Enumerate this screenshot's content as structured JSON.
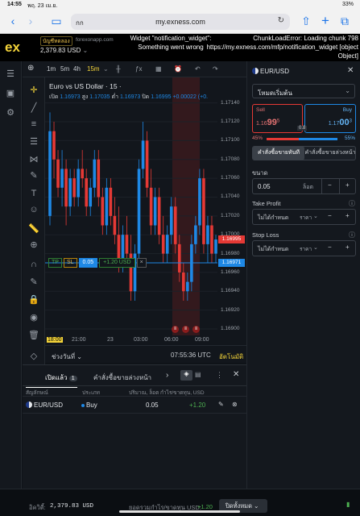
{
  "status": {
    "time": "14:55",
    "date": "พฤ. 23 เม.ย.",
    "battery": "33%"
  },
  "browser": {
    "aa": "กก",
    "url": "my.exness.com"
  },
  "header": {
    "logo": "ex",
    "account_type": "บัญชีทดลอง",
    "site": "forexonapp.com",
    "balance": "2,379.83 USD",
    "error_widget": "Widget \"notification_widget\": Something went wrong",
    "error_chunk": "ChunkLoadError: Loading chunk 798 https://my.exness.com/mfp/notification_widget [object Object]"
  },
  "chart_toolbar": {
    "timeframes": [
      "1m",
      "5m",
      "4h",
      "15m"
    ],
    "active": "15m"
  },
  "chart": {
    "title": "Euro vs US Dollar · 15 ·",
    "ohlc": {
      "open_label": "เปิด",
      "open": "1.16973",
      "high_label": "สูง",
      "high": "1.17035",
      "low_label": "ต่ำ",
      "low": "1.16973",
      "close_label": "ปิด",
      "close": "1.16995",
      "change": "+0.00022 (+0."
    },
    "price_axis": [
      "1.17140",
      "1.17120",
      "1.17100",
      "1.17080",
      "1.17060",
      "1.17040",
      "1.17020",
      "1.17000",
      "1.16980",
      "1.16960",
      "1.16940",
      "1.16920",
      "1.16900"
    ],
    "current_price": "1.16995",
    "line_price": "1.16971",
    "x_ticks": [
      "18:00",
      "21:00",
      "23",
      "03:00",
      "06:00",
      "09:00"
    ],
    "position": {
      "tp": "TP",
      "sl": "SL",
      "volume": "0.05",
      "pnl": "+1.20 USD",
      "close": "×"
    },
    "events": [
      "≡",
      "≡",
      "≡"
    ],
    "footer_range": "ช่วงวันที่",
    "clock": "07:55:36 UTC",
    "auto": "อัตโนมัติ"
  },
  "chart_data": {
    "type": "candlestick",
    "symbol": "EURUSD",
    "timeframe": "15m",
    "ylim": [
      1.169,
      1.1715
    ],
    "x_ticks": [
      "18:00",
      "21:00",
      "23",
      "03:00",
      "06:00",
      "09:00"
    ],
    "candles": [
      [
        1.1702,
        1.1713,
        1.1701,
        1.1711
      ],
      [
        1.1711,
        1.1712,
        1.1706,
        1.1708
      ],
      [
        1.1708,
        1.1709,
        1.1704,
        1.1705
      ],
      [
        1.1705,
        1.1709,
        1.1703,
        1.1707
      ],
      [
        1.1707,
        1.1708,
        1.1701,
        1.1703
      ],
      [
        1.1703,
        1.1707,
        1.1702,
        1.1706
      ],
      [
        1.1706,
        1.1707,
        1.1703,
        1.1704
      ],
      [
        1.1704,
        1.1708,
        1.1703,
        1.1707
      ],
      [
        1.1707,
        1.1709,
        1.1705,
        1.1706
      ],
      [
        1.1706,
        1.1707,
        1.1702,
        1.1703
      ],
      [
        1.1703,
        1.1706,
        1.1702,
        1.1705
      ],
      [
        1.1705,
        1.1709,
        1.1704,
        1.1708
      ],
      [
        1.1708,
        1.1709,
        1.1703,
        1.1704
      ],
      [
        1.1704,
        1.1705,
        1.17,
        1.1701
      ],
      [
        1.1701,
        1.1706,
        1.17,
        1.1705
      ],
      [
        1.1705,
        1.1706,
        1.1701,
        1.1702
      ],
      [
        1.1702,
        1.1704,
        1.1699,
        1.17
      ],
      [
        1.17,
        1.1703,
        1.1696,
        1.1697
      ],
      [
        1.1697,
        1.1701,
        1.1696,
        1.17
      ],
      [
        1.17,
        1.1702,
        1.1697,
        1.1698
      ],
      [
        1.1698,
        1.17,
        1.1693,
        1.1694
      ],
      [
        1.1694,
        1.1699,
        1.1693,
        1.1698
      ],
      [
        1.1698,
        1.1708,
        1.1697,
        1.1707
      ],
      [
        1.1707,
        1.1712,
        1.1706,
        1.171
      ],
      [
        1.171,
        1.1711,
        1.1704,
        1.1705
      ],
      [
        1.1705,
        1.1707,
        1.17,
        1.1701
      ],
      [
        1.1701,
        1.1705,
        1.17,
        1.1704
      ],
      [
        1.1704,
        1.1705,
        1.1699,
        1.17
      ],
      [
        1.17,
        1.1702,
        1.1697,
        1.1698
      ],
      [
        1.1698,
        1.1701,
        1.1697,
        1.17
      ],
      [
        1.17,
        1.1704,
        1.1699,
        1.1703
      ],
      [
        1.1703,
        1.1704,
        1.1698,
        1.1699
      ],
      [
        1.1699,
        1.17,
        1.1695,
        1.1696
      ],
      [
        1.1696,
        1.1697,
        1.1693,
        1.1694
      ],
      [
        1.1694,
        1.1696,
        1.1693,
        1.1695
      ],
      [
        1.1695,
        1.17,
        1.1694,
        1.1699
      ],
      [
        1.1699,
        1.1702,
        1.1698,
        1.1701
      ],
      [
        1.1701,
        1.1707,
        1.17,
        1.1706
      ],
      [
        1.1706,
        1.1707,
        1.1698,
        1.1699
      ],
      [
        1.1699,
        1.1702,
        1.1697,
        1.1701
      ],
      [
        1.1701,
        1.1702,
        1.1697,
        1.1698
      ],
      [
        1.1698,
        1.17,
        1.1697,
        1.16995
      ]
    ]
  },
  "right_panel": {
    "symbol": "EUR/USD",
    "mode": "โหมดเริ่มต้น",
    "sell_label": "Sell",
    "sell_price_main": "1.16",
    "sell_price_big": "99",
    "sell_price_small": "5",
    "buy_label": "Buy",
    "buy_price_main": "1.17",
    "buy_price_big": "00",
    "buy_price_small": "3",
    "spread": "0.8",
    "sell_pct": "45%",
    "buy_pct": "55%",
    "sentiment_buy_fraction": 0.55,
    "tab_market": "คำสั่งซื้อขายทันที",
    "tab_pending": "คำสั่งซื้อขายล่วงหน้า",
    "volume_label": "ขนาด",
    "volume": "0.05",
    "volume_unit": "ล็อต",
    "tp_label": "Take Profit",
    "tp_value": "ไม่ได้กำหนด",
    "tp_unit": "ราคา",
    "sl_label": "Stop Loss",
    "sl_value": "ไม่ได้กำหนด",
    "sl_unit": "ราคา"
  },
  "bottom": {
    "tab_open": "เปิดแล้ว",
    "tab_open_count": "1",
    "tab_pending": "คำสั่งซื้อขายล่วงหน้า",
    "columns": [
      "สัญลักษณ์",
      "ประเภท",
      "ปริมาณ, ล็อต",
      "กำไร/ขาดทุน, USD"
    ],
    "rows": [
      {
        "symbol": "EUR/USD",
        "type": "Buy",
        "volume": "0.05",
        "pnl": "+1.20"
      }
    ]
  },
  "footer": {
    "equity_label": "อิควิตี้:",
    "equity": "2,379.83 USD",
    "total_label": "ยอดรวมกำไร/ขาดทุน USD:",
    "total": "+1.20",
    "close_all": "ปิดทั้งหมด"
  },
  "colors": {
    "buy": "#1e88e5",
    "sell": "#e53935",
    "up": "#1e88e5",
    "down": "#e53935",
    "accent": "#f5d53a"
  }
}
